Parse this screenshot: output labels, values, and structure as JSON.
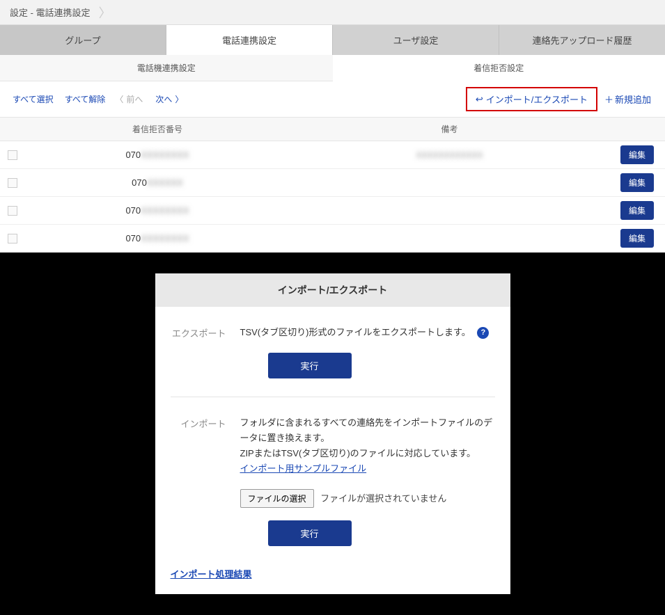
{
  "breadcrumb": {
    "title": "設定 - 電話連携設定"
  },
  "mainTabs": [
    "グループ",
    "電話連携設定",
    "ユーザ設定",
    "連絡先アップロード履歴"
  ],
  "subTabs": [
    "電話機連携設定",
    "着信拒否設定"
  ],
  "toolbar": {
    "selectAll": "すべて選択",
    "deselectAll": "すべて解除",
    "prev": "前へ",
    "next": "次へ",
    "importExport": "インポート/エクスポート",
    "addNew": "新規追加"
  },
  "tableHeaders": {
    "number": "着信拒否番号",
    "note": "備考"
  },
  "rows": [
    {
      "number": "070",
      "numberBlur": "XXXXXXXX",
      "note": "",
      "noteBlur": "XXXXXXXXXXXX"
    },
    {
      "number": "070",
      "numberBlur": "XXXXXX",
      "note": "",
      "noteBlur": ""
    },
    {
      "number": "070",
      "numberBlur": "XXXXXXXX",
      "note": "",
      "noteBlur": ""
    },
    {
      "number": "070",
      "numberBlur": "XXXXXXXX",
      "note": "",
      "noteBlur": ""
    }
  ],
  "editLabel": "編集",
  "panel": {
    "title": "インポート/エクスポート",
    "export": {
      "label": "エクスポート",
      "desc": "TSV(タブ区切り)形式のファイルをエクスポートします。",
      "exec": "実行"
    },
    "import": {
      "label": "インポート",
      "desc1": "フォルダに含まれるすべての連絡先をインポートファイルのデータに置き換えます。",
      "desc2": "ZIPまたはTSV(タブ区切り)のファイルに対応しています。",
      "sampleLink": "インポート用サンプルファイル",
      "fileBtn": "ファイルの選択",
      "fileStatus": "ファイルが選択されていません",
      "exec": "実行"
    },
    "resultLink": "インポート処理結果"
  }
}
